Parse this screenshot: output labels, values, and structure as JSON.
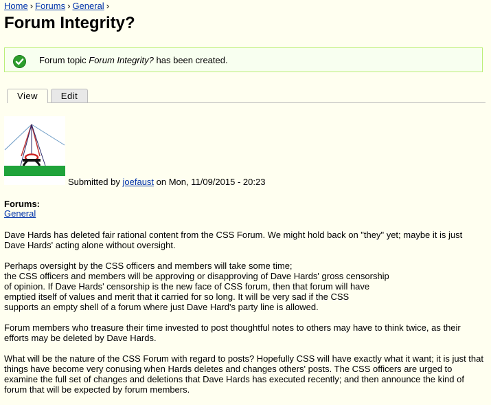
{
  "breadcrumb": {
    "home": "Home",
    "forums": "Forums",
    "general": "General",
    "separator": "›"
  },
  "page": {
    "title": "Forum Integrity?"
  },
  "status": {
    "prefix": "Forum topic ",
    "topic": "Forum Integrity?",
    "suffix": " has been created.",
    "icon": "check-circle-icon",
    "color": "#2d9e2d"
  },
  "tabs": {
    "view": "View",
    "edit": "Edit"
  },
  "submission": {
    "prefix": "Submitted by ",
    "author": "joefaust",
    "suffix": " on Mon, 11/09/2015 - 20:23"
  },
  "forums": {
    "label": "Forums:",
    "link": "General"
  },
  "body": {
    "p1": "Dave Hards has deleted fair rational content from the CSS Forum.  We might hold back on \"they\" yet; maybe it is just Dave Hards' acting alone without oversight.",
    "p2": "Perhaps oversight by the CSS officers and members will take some time;\nthe CSS officers and members will be approving or disapproving of Dave Hards' gross censorship\nof opinion.  If Dave Hards' censorship is the new face of CSS forum, then that forum will have\nemptied itself of values and merit that it carried for so long.   It will be very sad if the CSS\nsupports an empty shell of a forum where just Dave Hard's party line is allowed.",
    "p3": "Forum members who treasure their time invested to post thoughtful notes to others may have to think twice, as their efforts may be deleted by Dave Hards.",
    "p4": "What will be the nature of the CSS Forum with regard to posts? Hopefully CSS will have exactly what it want; it is just that things have become very conusing when Hards deletes and changes others' posts.  The CSS officers are urged to examine the full set of changes and deletions that Dave Hards has executed recently; and then announce the kind of forum that will be expected by forum members."
  }
}
